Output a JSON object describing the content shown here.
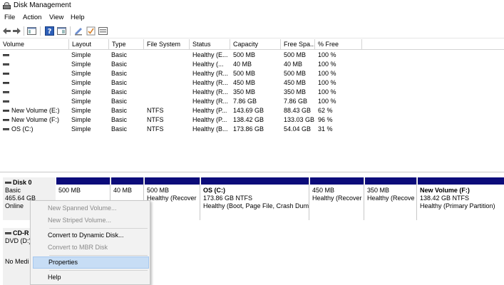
{
  "window": {
    "title": "Disk Management"
  },
  "menu": {
    "file": "File",
    "action": "Action",
    "view": "View",
    "help": "Help"
  },
  "volumes": {
    "columns": [
      "Volume",
      "Layout",
      "Type",
      "File System",
      "Status",
      "Capacity",
      "Free Spa...",
      "% Free"
    ],
    "rows": [
      {
        "volume": "",
        "layout": "Simple",
        "type": "Basic",
        "fs": "",
        "status": "Healthy (E...",
        "capacity": "500 MB",
        "free": "500 MB",
        "pct": "100 %"
      },
      {
        "volume": "",
        "layout": "Simple",
        "type": "Basic",
        "fs": "",
        "status": "Healthy (...",
        "capacity": "40 MB",
        "free": "40 MB",
        "pct": "100 %"
      },
      {
        "volume": "",
        "layout": "Simple",
        "type": "Basic",
        "fs": "",
        "status": "Healthy (R...",
        "capacity": "500 MB",
        "free": "500 MB",
        "pct": "100 %"
      },
      {
        "volume": "",
        "layout": "Simple",
        "type": "Basic",
        "fs": "",
        "status": "Healthy (R...",
        "capacity": "450 MB",
        "free": "450 MB",
        "pct": "100 %"
      },
      {
        "volume": "",
        "layout": "Simple",
        "type": "Basic",
        "fs": "",
        "status": "Healthy (R...",
        "capacity": "350 MB",
        "free": "350 MB",
        "pct": "100 %"
      },
      {
        "volume": "",
        "layout": "Simple",
        "type": "Basic",
        "fs": "",
        "status": "Healthy (R...",
        "capacity": "7.86 GB",
        "free": "7.86 GB",
        "pct": "100 %"
      },
      {
        "volume": "New Volume (E:)",
        "layout": "Simple",
        "type": "Basic",
        "fs": "NTFS",
        "status": "Healthy (P...",
        "capacity": "143.69 GB",
        "free": "88.43 GB",
        "pct": "62 %"
      },
      {
        "volume": "New Volume (F:)",
        "layout": "Simple",
        "type": "Basic",
        "fs": "NTFS",
        "status": "Healthy (P...",
        "capacity": "138.42 GB",
        "free": "133.03 GB",
        "pct": "96 %"
      },
      {
        "volume": "OS (C:)",
        "layout": "Simple",
        "type": "Basic",
        "fs": "NTFS",
        "status": "Healthy (B...",
        "capacity": "173.86 GB",
        "free": "54.04 GB",
        "pct": "31 %"
      }
    ]
  },
  "disk0": {
    "name": "Disk 0",
    "type": "Basic",
    "size": "465.64 GB",
    "status": "Online",
    "partitions": [
      {
        "name": "",
        "size": "500 MB",
        "status": ""
      },
      {
        "name": "",
        "size": "40 MB",
        "status": ""
      },
      {
        "name": "",
        "size": "500 MB",
        "status": "Healthy (Recover"
      },
      {
        "name": "OS  (C:)",
        "size": "173.86 GB NTFS",
        "status": "Healthy (Boot, Page File, Crash Dum"
      },
      {
        "name": "",
        "size": "450 MB",
        "status": "Healthy (Recover"
      },
      {
        "name": "",
        "size": "350 MB",
        "status": "Healthy (Recove"
      },
      {
        "name": "New Volume  (F:)",
        "size": "138.42 GB NTFS",
        "status": "Healthy (Primary Partition)"
      }
    ]
  },
  "cdrom": {
    "name": "CD-R",
    "type": "DVD (D:)",
    "media": "No Medi"
  },
  "context_menu": {
    "items": [
      {
        "label": "New Spanned Volume...",
        "enabled": false
      },
      {
        "label": "New Striped Volume...",
        "enabled": false
      },
      {
        "label": "Convert to Dynamic Disk...",
        "enabled": true
      },
      {
        "label": "Convert to MBR Disk",
        "enabled": false
      },
      {
        "label": "Properties",
        "enabled": true,
        "highlighted": true
      },
      {
        "label": "Help",
        "enabled": true
      }
    ]
  },
  "colors": {
    "partition_bar": "#0c0c7a",
    "highlight": "#c7ddf5"
  }
}
